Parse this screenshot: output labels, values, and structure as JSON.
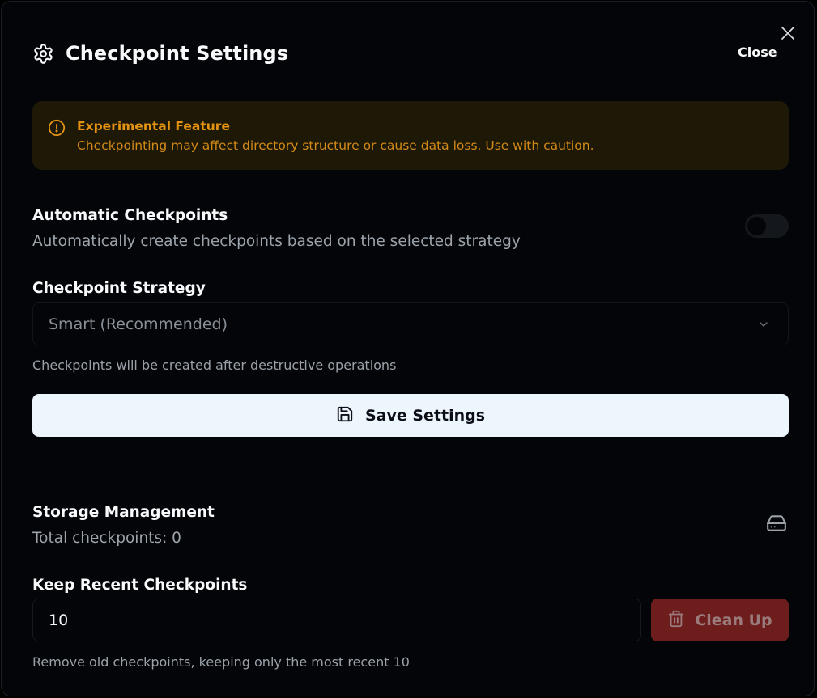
{
  "dialog": {
    "title": "Checkpoint Settings",
    "title_icon": "gear-icon",
    "close_label": "Close",
    "close_icon": "close-x-icon"
  },
  "warning": {
    "icon": "alert-circle-icon",
    "title": "Experimental Feature",
    "text": "Checkpointing may affect directory structure or cause data loss. Use with caution.",
    "color": "#e39212"
  },
  "auto_checkpoints": {
    "label": "Automatic Checkpoints",
    "description": "Automatically create checkpoints based on the selected strategy",
    "enabled": false
  },
  "strategy": {
    "label": "Checkpoint Strategy",
    "selected": "Smart (Recommended)",
    "hint": "Checkpoints will be created after destructive operations"
  },
  "save": {
    "label": "Save Settings",
    "icon": "floppy-disk-icon"
  },
  "storage": {
    "title": "Storage Management",
    "total": "Total checkpoints: 0",
    "icon": "hard-drive-icon"
  },
  "keep_recent": {
    "label": "Keep Recent Checkpoints",
    "value": "10",
    "cleanup_label": "Clean Up",
    "cleanup_icon": "trash-icon",
    "hint": "Remove old checkpoints, keeping only the most recent 10"
  }
}
